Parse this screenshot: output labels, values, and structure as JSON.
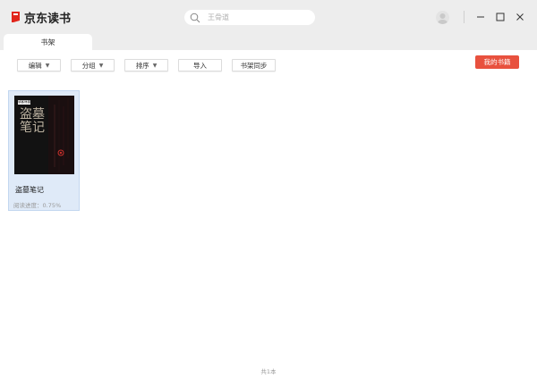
{
  "app": {
    "name": "京东读书"
  },
  "search": {
    "placeholder": "王骨道"
  },
  "tabs": [
    {
      "label": "书架"
    }
  ],
  "toolbar": {
    "edit_label": "编辑",
    "group_label": "分组",
    "sort_label": "排序",
    "import_label": "导入",
    "sync_label": "书架同步",
    "my_books_label": "我的书籍"
  },
  "books": [
    {
      "title": "盗墓笔记",
      "progress": "阅读进度：0.75%",
      "cover_title": "盗墓笔记",
      "cover_publisher": "读客熊猫"
    }
  ],
  "footer": {
    "count": "共1本"
  },
  "colors": {
    "accent": "#e8513e",
    "selected_card": "#dfeaf8",
    "titlebar": "#ededed"
  }
}
